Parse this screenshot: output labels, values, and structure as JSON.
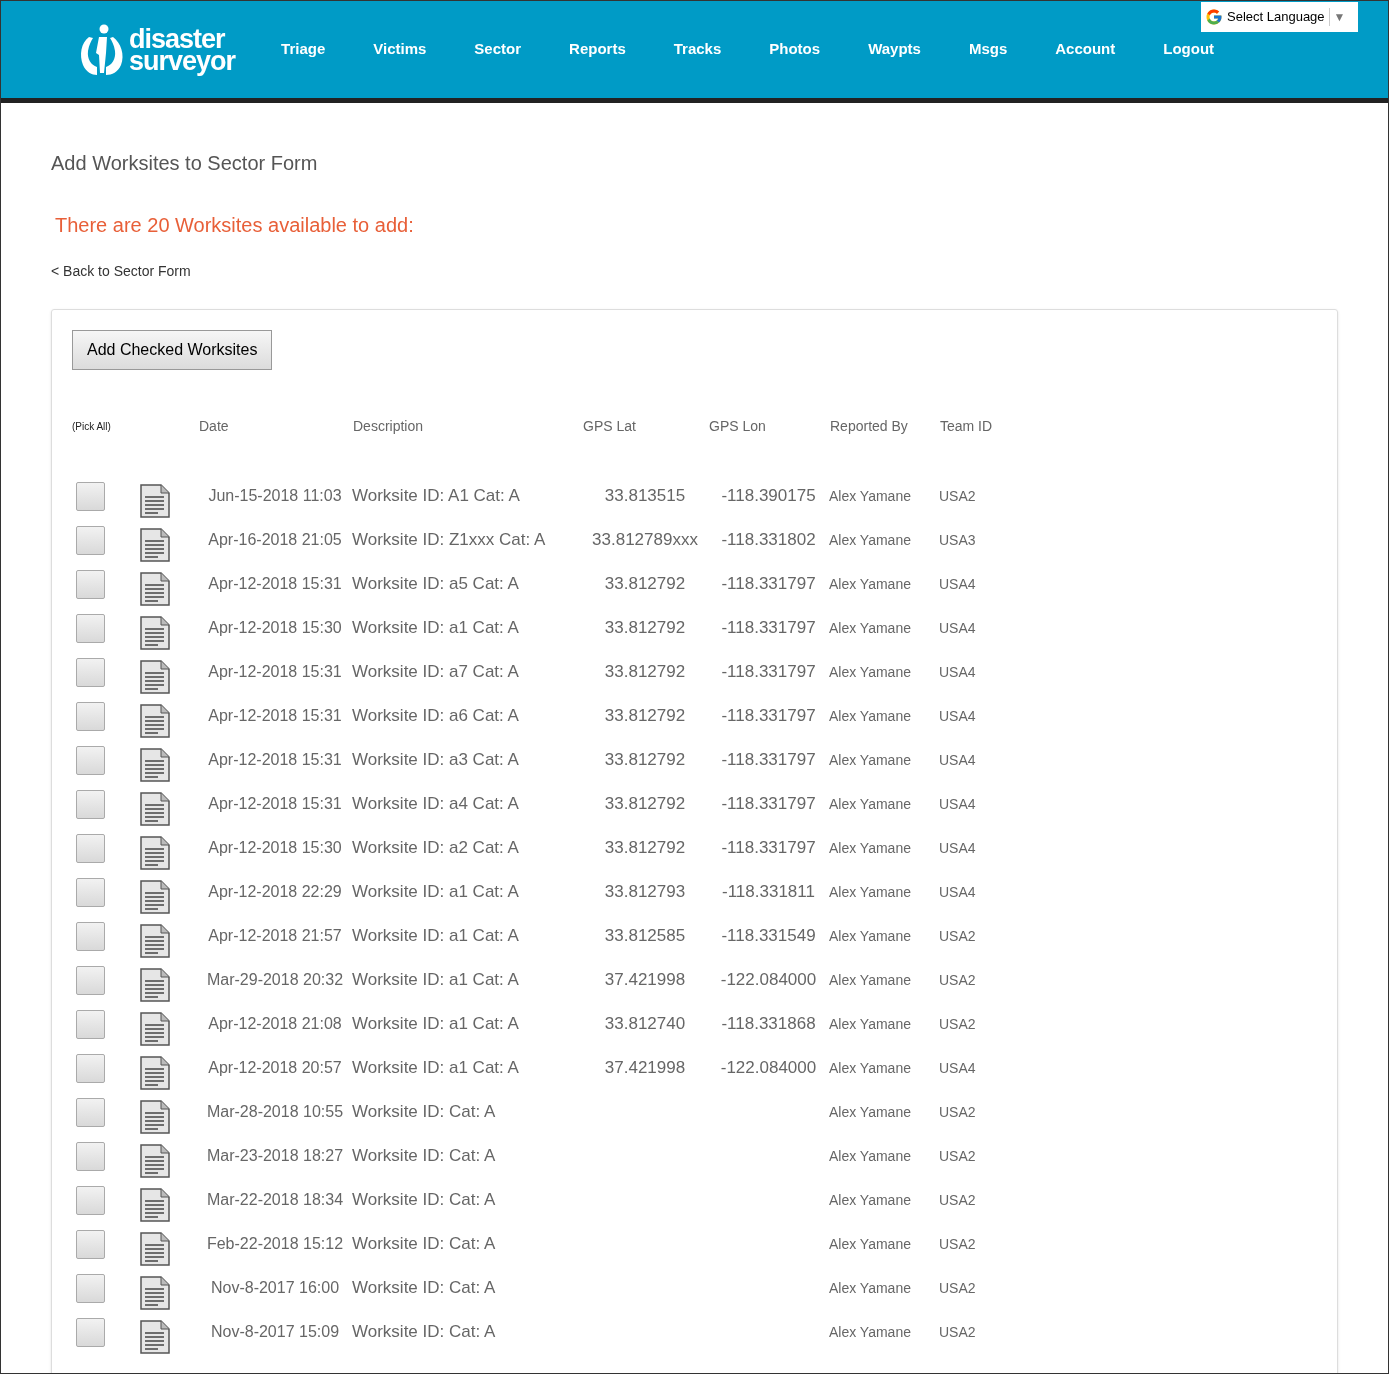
{
  "header": {
    "logo": {
      "line1": "disaster",
      "line2": "surveyor"
    },
    "nav": [
      {
        "label": "Triage"
      },
      {
        "label": "Victims"
      },
      {
        "label": "Sector"
      },
      {
        "label": "Reports"
      },
      {
        "label": "Tracks"
      },
      {
        "label": "Photos"
      },
      {
        "label": "Waypts"
      },
      {
        "label": "Msgs"
      },
      {
        "label": "Account"
      },
      {
        "label": "Logout"
      }
    ],
    "language_select": {
      "label": "Select Language",
      "arrow": "▼"
    }
  },
  "page_title": "Add Worksites to Sector Form",
  "notice": "There are 20 Worksites available to add:",
  "back_link": "< Back to Sector Form",
  "add_button": "Add Checked Worksites",
  "table": {
    "columns": [
      "(Pick All)",
      "Date",
      "Description",
      "GPS Lat",
      "GPS Lon",
      "Reported By",
      "Team ID"
    ],
    "rows": [
      {
        "checked": false,
        "date": "Jun-15-2018 11:03",
        "description": "Worksite ID: A1 Cat: A",
        "lat": "33.813515",
        "lon": "-118.390175",
        "reported_by": "Alex Yamane",
        "team": "USA2"
      },
      {
        "checked": false,
        "date": "Apr-16-2018 21:05",
        "description": "Worksite ID: Z1xxx Cat: A",
        "lat": "33.812789xxx",
        "lon": "-118.331802",
        "reported_by": "Alex Yamane",
        "team": "USA3"
      },
      {
        "checked": false,
        "date": "Apr-12-2018 15:31",
        "description": "Worksite ID: a5 Cat: A",
        "lat": "33.812792",
        "lon": "-118.331797",
        "reported_by": "Alex Yamane",
        "team": "USA4"
      },
      {
        "checked": false,
        "date": "Apr-12-2018 15:30",
        "description": "Worksite ID: a1 Cat: A",
        "lat": "33.812792",
        "lon": "-118.331797",
        "reported_by": "Alex Yamane",
        "team": "USA4"
      },
      {
        "checked": false,
        "date": "Apr-12-2018 15:31",
        "description": "Worksite ID: a7 Cat: A",
        "lat": "33.812792",
        "lon": "-118.331797",
        "reported_by": "Alex Yamane",
        "team": "USA4"
      },
      {
        "checked": false,
        "date": "Apr-12-2018 15:31",
        "description": "Worksite ID: a6 Cat: A",
        "lat": "33.812792",
        "lon": "-118.331797",
        "reported_by": "Alex Yamane",
        "team": "USA4"
      },
      {
        "checked": false,
        "date": "Apr-12-2018 15:31",
        "description": "Worksite ID: a3 Cat: A",
        "lat": "33.812792",
        "lon": "-118.331797",
        "reported_by": "Alex Yamane",
        "team": "USA4"
      },
      {
        "checked": false,
        "date": "Apr-12-2018 15:31",
        "description": "Worksite ID: a4 Cat: A",
        "lat": "33.812792",
        "lon": "-118.331797",
        "reported_by": "Alex Yamane",
        "team": "USA4"
      },
      {
        "checked": false,
        "date": "Apr-12-2018 15:30",
        "description": "Worksite ID: a2 Cat: A",
        "lat": "33.812792",
        "lon": "-118.331797",
        "reported_by": "Alex Yamane",
        "team": "USA4"
      },
      {
        "checked": false,
        "date": "Apr-12-2018 22:29",
        "description": "Worksite ID: a1 Cat: A",
        "lat": "33.812793",
        "lon": "-118.331811",
        "reported_by": "Alex Yamane",
        "team": "USA4"
      },
      {
        "checked": false,
        "date": "Apr-12-2018 21:57",
        "description": "Worksite ID: a1 Cat: A",
        "lat": "33.812585",
        "lon": "-118.331549",
        "reported_by": "Alex Yamane",
        "team": "USA2"
      },
      {
        "checked": false,
        "date": "Mar-29-2018 20:32",
        "description": "Worksite ID: a1 Cat: A",
        "lat": "37.421998",
        "lon": "-122.084000",
        "reported_by": "Alex Yamane",
        "team": "USA2"
      },
      {
        "checked": false,
        "date": "Apr-12-2018 21:08",
        "description": "Worksite ID: a1 Cat: A",
        "lat": "33.812740",
        "lon": "-118.331868",
        "reported_by": "Alex Yamane",
        "team": "USA2"
      },
      {
        "checked": false,
        "date": "Apr-12-2018 20:57",
        "description": "Worksite ID: a1 Cat: A",
        "lat": "37.421998",
        "lon": "-122.084000",
        "reported_by": "Alex Yamane",
        "team": "USA4"
      },
      {
        "checked": false,
        "date": "Mar-28-2018 10:55",
        "description": "Worksite ID: Cat: A",
        "reported_by": "Alex Yamane",
        "team": "USA2"
      },
      {
        "checked": false,
        "date": "Mar-23-2018 18:27",
        "description": "Worksite ID: Cat: A",
        "reported_by": "Alex Yamane",
        "team": "USA2"
      },
      {
        "checked": false,
        "date": "Mar-22-2018 18:34",
        "description": "Worksite ID: Cat: A",
        "reported_by": "Alex Yamane",
        "team": "USA2"
      },
      {
        "checked": false,
        "date": "Feb-22-2018 15:12",
        "description": "Worksite ID: Cat: A",
        "reported_by": "Alex Yamane",
        "team": "USA2"
      },
      {
        "checked": false,
        "date": "Nov-8-2017 16:00",
        "description": "Worksite ID: Cat: A",
        "reported_by": "Alex Yamane",
        "team": "USA2"
      },
      {
        "checked": false,
        "date": "Nov-8-2017 15:09",
        "description": "Worksite ID: Cat: A",
        "reported_by": "Alex Yamane",
        "team": "USA2"
      }
    ]
  }
}
